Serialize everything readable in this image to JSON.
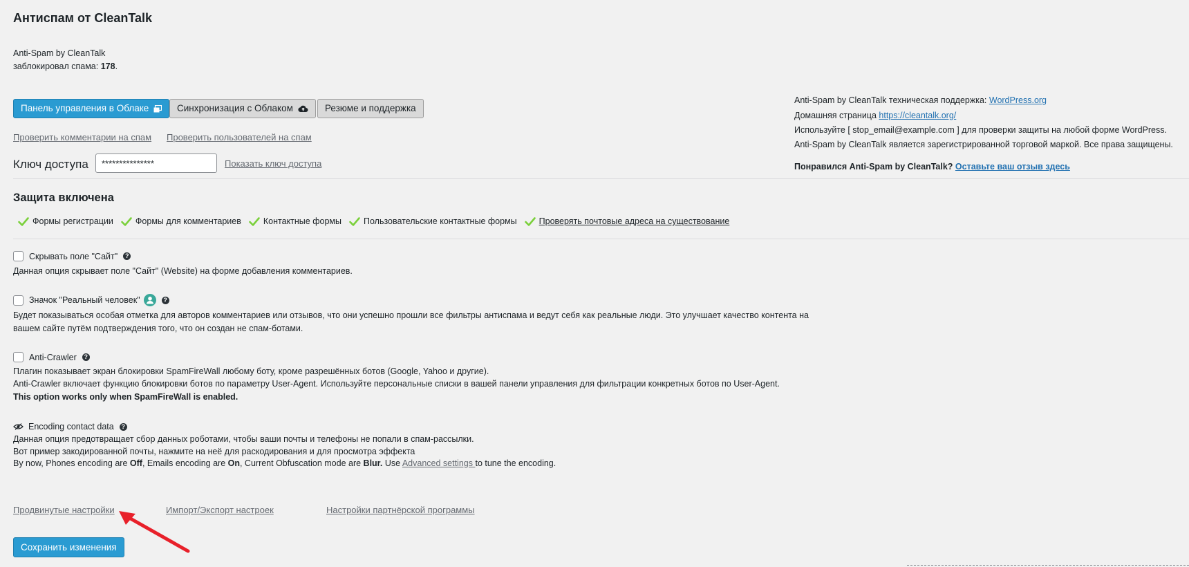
{
  "header": {
    "title": "Антиспам от CleanTalk",
    "plugin_name": "Anti-Spam by CleanTalk",
    "blocked_prefix": "заблокировал спама:",
    "blocked_count": "178",
    "blocked_suffix": "."
  },
  "buttons": {
    "cloud_panel": "Панель управления в Облаке",
    "sync": "Синхронизация с Облаком",
    "summary": "Резюме и поддержка",
    "save": "Сохранить изменения"
  },
  "links": {
    "check_comments": "Проверить комментарии на спам",
    "check_users": "Проверить пользователей на спам",
    "show_key": "Показать ключ доступа"
  },
  "access_key": {
    "label": "Ключ доступа",
    "value": "***************"
  },
  "right_info": {
    "support_prefix": "Anti-Spam by CleanTalk техническая поддержка:",
    "support_link": "WordPress.org",
    "homepage_prefix": "Домашняя страница",
    "homepage_link": "https://cleantalk.org/",
    "use_text": "Используйте [ stop_email@example.com ] для проверки защиты на любой форме WordPress.",
    "trademark_text": "Anti-Spam by CleanTalk является зарегистрированной торговой маркой. Все права защищены.",
    "review_prefix": "Понравился Anti-Spam by CleanTalk?",
    "review_link": "Оставьте ваш отзыв здесь"
  },
  "protection": {
    "title": "Защита включена",
    "features": [
      "Формы регистрации",
      "Формы для комментариев",
      "Контактные формы",
      "Пользовательские контактные формы",
      "Проверять почтовые адреса на существование"
    ]
  },
  "options": {
    "hide_site": {
      "label": "Скрывать поле \"Сайт\"",
      "desc": "Данная опция скрывает поле \"Сайт\" (Website) на форме добавления комментариев."
    },
    "real_person": {
      "label": "Значок \"Реальный человек\"",
      "desc1": "Будет показываться особая отметка для авторов комментариев или отзывов, что они успешно прошли все фильтры антиспама и ведут себя как реальные люди. Это улучшает качество контента на",
      "desc2": "вашем сайте путём подтверждения того, что он создан не спам-ботами."
    },
    "anti_crawler": {
      "label": "Anti-Crawler",
      "desc1": "Плагин показывает экран блокировки SpamFireWall любому боту, кроме разрешённых ботов (Google, Yahoo и другие).",
      "desc2": "Anti-Crawler включает функцию блокировки ботов по параметру User-Agent. Используйте персональные списки в вашей панели управления для фильтрации конкретных ботов по User-Agent.",
      "desc3": "This option works only when SpamFireWall is enabled."
    },
    "encoding": {
      "label": "Encoding contact data",
      "desc1": "Данная опция предотвращает сбор данных роботами, чтобы ваши почты и телефоны не попали в спам-рассылки.",
      "desc2": "Вот пример закодированной почты, нажмите на неё для раскодирования и для просмотра эффекта",
      "s_prefix": "By now, Phones encoding are ",
      "s_phones": "Off",
      "s_mid1": ", Emails encoding are ",
      "s_emails": "On",
      "s_mid2": ", Current Obfuscation mode are ",
      "s_mode": "Blur.",
      "s_use": " Use ",
      "s_link": "Advanced settings ",
      "s_suffix": "to tune the encoding."
    }
  },
  "footer_links": {
    "advanced": "Продвинутые настройки",
    "import_export": "Импорт/Экспорт настроек",
    "partner": "Настройки партнёрской программы"
  },
  "colors": {
    "primary_button": "#2a9bd2",
    "link": "#2271b1",
    "check": "#7ad03a",
    "arrow": "#e8202a"
  }
}
